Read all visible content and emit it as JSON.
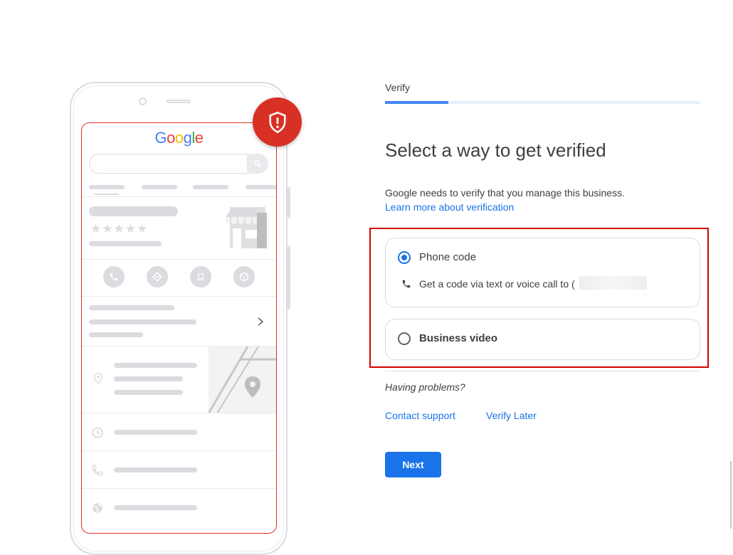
{
  "illustration": {
    "logo_letters": [
      {
        "ch": "G",
        "color": "#4285F4"
      },
      {
        "ch": "o",
        "color": "#EA4335"
      },
      {
        "ch": "o",
        "color": "#FBBC05"
      },
      {
        "ch": "g",
        "color": "#4285F4"
      },
      {
        "ch": "l",
        "color": "#34A853"
      },
      {
        "ch": "e",
        "color": "#EA4335"
      }
    ],
    "stars": "★★★★★",
    "badge_icon": "shield-alert-icon"
  },
  "verify": {
    "step_label": "Verify",
    "progress": 0.2,
    "title": "Select a way to get verified",
    "description": "Google needs to verify that you manage this business.",
    "learn_more": "Learn more about verification",
    "options": [
      {
        "label": "Phone code",
        "selected": true,
        "detail": "Get a code via text or voice call to ("
      },
      {
        "label": "Business video",
        "selected": false
      }
    ],
    "problems": "Having problems?",
    "contact_support": "Contact support",
    "verify_later": "Verify Later",
    "next": "Next"
  },
  "colors": {
    "accent": "#1a73e8",
    "alert_red": "#d93025",
    "highlight_red": "#d50000"
  }
}
